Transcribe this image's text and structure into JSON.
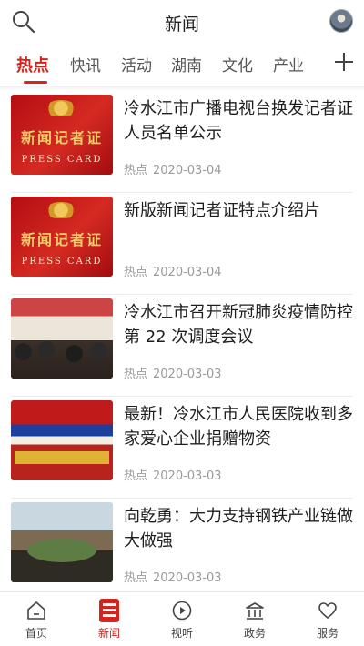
{
  "header": {
    "title": "新闻"
  },
  "tabs": [
    {
      "label": "热点"
    },
    {
      "label": "快讯"
    },
    {
      "label": "活动"
    },
    {
      "label": "湖南"
    },
    {
      "label": "文化"
    },
    {
      "label": "产业"
    }
  ],
  "news": [
    {
      "title": "冷水江市广播电视台换发记者证人员名单公示",
      "tag": "热点",
      "date": "2020-03-04",
      "thumb_cn": "新闻记者证",
      "thumb_en": "PRESS CARD"
    },
    {
      "title": "新版新闻记者证特点介绍片",
      "tag": "热点",
      "date": "2020-03-04",
      "thumb_cn": "新闻记者证",
      "thumb_en": "PRESS CARD"
    },
    {
      "title": "冷水江市召开新冠肺炎疫情防控第 22 次调度会议",
      "tag": "热点",
      "date": "2020-03-03"
    },
    {
      "title": "最新！冷水江市人民医院收到多家爱心企业捐赠物资",
      "tag": "热点",
      "date": "2020-03-03"
    },
    {
      "title": "向乾勇：大力支持钢铁产业链做大做强",
      "tag": "热点",
      "date": "2020-03-03"
    }
  ],
  "bottom_nav": [
    {
      "label": "首页",
      "icon": "home-icon"
    },
    {
      "label": "新闻",
      "icon": "news-icon",
      "active": true
    },
    {
      "label": "视听",
      "icon": "video-icon"
    },
    {
      "label": "政务",
      "icon": "government-icon"
    },
    {
      "label": "服务",
      "icon": "heart-icon"
    }
  ],
  "colors": {
    "accent": "#d0261f"
  }
}
